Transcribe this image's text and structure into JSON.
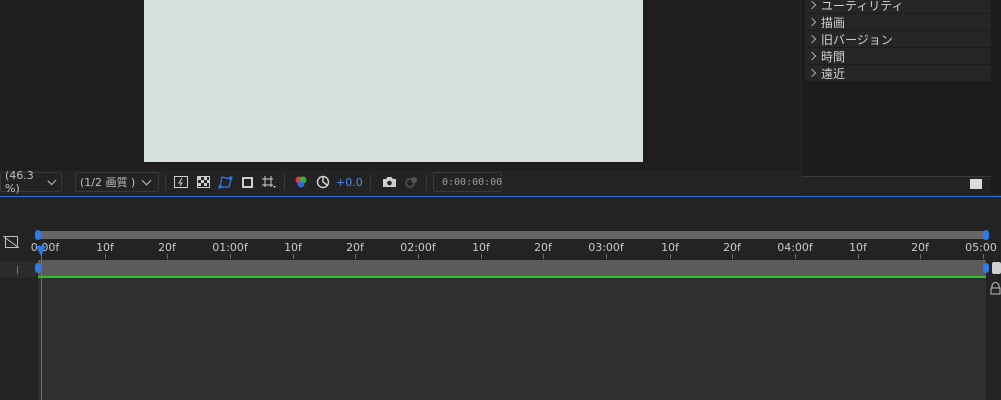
{
  "viewer_toolbar": {
    "zoom": "(46.3 %)",
    "resolution": "(1/2 画質 )",
    "exposure": "+0.0",
    "timecode": "0:00:00:00"
  },
  "effects_panel": {
    "items": [
      "ユーティリティ",
      "描画",
      "旧バージョン",
      "時間",
      "遠近"
    ]
  },
  "timeline": {
    "ruler_labels": [
      "0:00f",
      "10f",
      "20f",
      "01:00f",
      "10f",
      "20f",
      "02:00f",
      "10f",
      "20f",
      "03:00f",
      "10f",
      "20f",
      "04:00f",
      "10f",
      "20f",
      "05:00"
    ]
  },
  "colors": {
    "accent_blue": "#2f7ae5",
    "canvas": "#d5e0dc",
    "green_line": "#2fbf2f"
  }
}
